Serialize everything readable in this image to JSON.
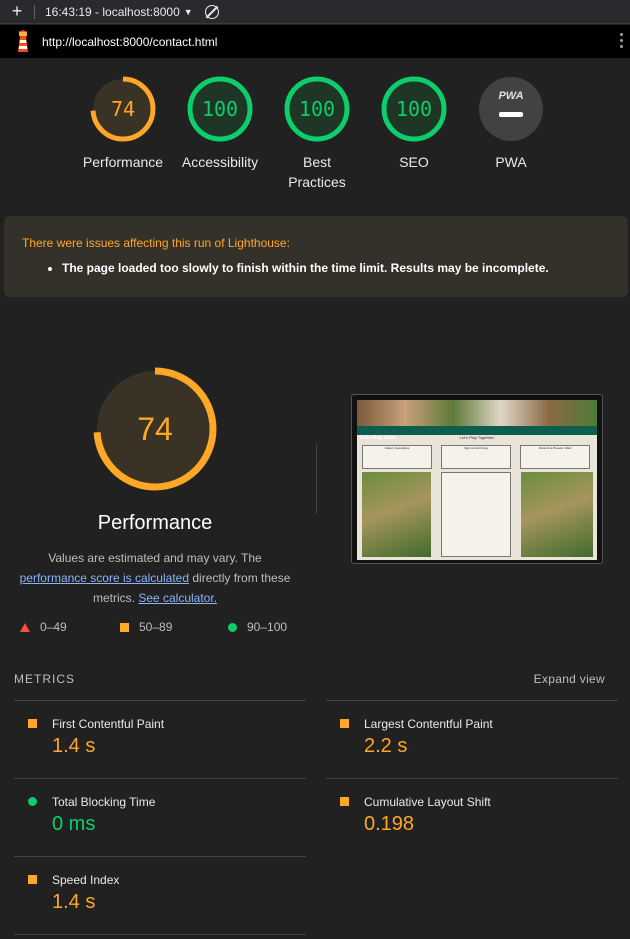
{
  "tabbar": {
    "time_host": "16:43:19 - localhost:8000"
  },
  "urlbar": {
    "url": "http://localhost:8000/contact.html"
  },
  "colors": {
    "orange": "#ffa726",
    "green": "#0cce6b",
    "red": "#ff4e42"
  },
  "gauges": [
    {
      "label": "Performance",
      "value": "74",
      "score": 0.74,
      "color": "#ffa726"
    },
    {
      "label": "Accessibility",
      "value": "100",
      "score": 1.0,
      "color": "#0cce6b"
    },
    {
      "label_line1": "Best",
      "label_line2": "Practices",
      "value": "100",
      "score": 1.0,
      "color": "#0cce6b"
    },
    {
      "label": "SEO",
      "value": "100",
      "score": 1.0,
      "color": "#0cce6b"
    },
    {
      "label": "PWA",
      "value": "PWA",
      "icon": "pwa-icon"
    }
  ],
  "warning": {
    "title": "There were issues affecting this run of Lighthouse:",
    "item": "The page loaded too slowly to finish within the time limit. Results may be incomplete."
  },
  "performance": {
    "score": "74",
    "title": "Performance",
    "desc_1": "Values are estimated and may vary. The",
    "link_score": "performance score is calculated",
    "desc_2": "directly from these",
    "desc_3": "metrics.",
    "link_calc": "See calculator."
  },
  "screenshot": {
    "site_title": "Cute Dog Luna",
    "subtitle": "Let's Play Together!",
    "col_titles": [
      "Gallery Specialties",
      "Night and All Dogs",
      "Distinctive Breeder Walk"
    ]
  },
  "legend": {
    "fail": "0–49",
    "average": "50–89",
    "pass": "90–100"
  },
  "metrics_header": {
    "title": "METRICS",
    "expand": "Expand view"
  },
  "metrics": [
    {
      "name": "First Contentful Paint",
      "value": "1.4 s",
      "status": "average"
    },
    {
      "name": "Largest Contentful Paint",
      "value": "2.2 s",
      "status": "average"
    },
    {
      "name": "Total Blocking Time",
      "value": "0 ms",
      "status": "pass"
    },
    {
      "name": "Cumulative Layout Shift",
      "value": "0.198",
      "status": "average"
    },
    {
      "name": "Speed Index",
      "value": "1.4 s",
      "status": "average"
    }
  ]
}
